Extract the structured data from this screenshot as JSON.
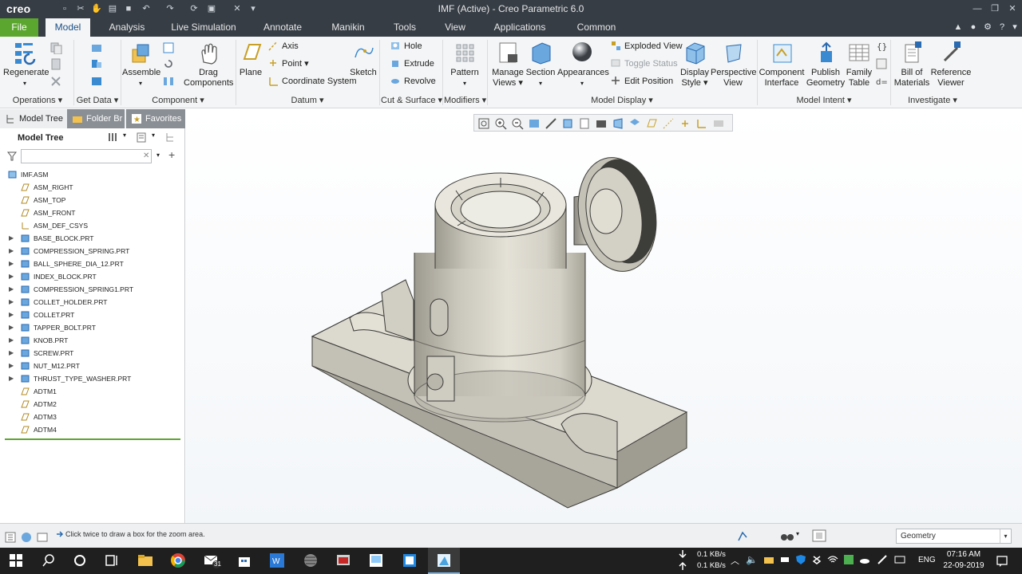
{
  "titlebar": {
    "app_logo": "creo",
    "title": "IMF (Active) - Creo Parametric 6.0"
  },
  "tabs": [
    "File",
    "Model",
    "Analysis",
    "Live Simulation",
    "Annotate",
    "Manikin",
    "Tools",
    "View",
    "Applications",
    "Common"
  ],
  "active_tab": "Model",
  "ribbon": {
    "operations": {
      "regenerate": "Regenerate",
      "group": "Operations"
    },
    "get_data": {
      "group": "Get Data"
    },
    "component": {
      "assemble": "Assemble",
      "drag": "Drag Components",
      "group": "Component"
    },
    "datum": {
      "plane": "Plane",
      "axis": "Axis",
      "point": "Point",
      "csys": "Coordinate System",
      "sketch": "Sketch",
      "group": "Datum"
    },
    "cut_surface": {
      "hole": "Hole",
      "extrude": "Extrude",
      "revolve": "Revolve",
      "group": "Cut & Surface"
    },
    "modifiers": {
      "pattern": "Pattern",
      "group": "Modifiers"
    },
    "model_display": {
      "manage_views": "Manage Views",
      "section": "Section",
      "appearances": "Appearances",
      "exploded_view": "Exploded View",
      "toggle_status": "Toggle Status",
      "edit_position": "Edit Position",
      "display_style": "Display Style",
      "perspective_view": "Perspective View",
      "group": "Model Display"
    },
    "model_intent": {
      "component_interface": "Component Interface",
      "publish_geometry": "Publish Geometry",
      "family_table": "Family Table",
      "group": "Model Intent"
    },
    "investigate": {
      "bom": "Bill of Materials",
      "reference_viewer": "Reference Viewer",
      "group": "Investigate"
    }
  },
  "left_panel": {
    "tabs": [
      "Model Tree",
      "Folder Br",
      "Favorites"
    ],
    "header": "Model Tree",
    "search_value": "",
    "tree": [
      {
        "label": "IMF.ASM",
        "type": "asm",
        "expand": false,
        "indent": 0
      },
      {
        "label": "ASM_RIGHT",
        "type": "plane",
        "expand": false,
        "indent": 1
      },
      {
        "label": "ASM_TOP",
        "type": "plane",
        "expand": false,
        "indent": 1
      },
      {
        "label": "ASM_FRONT",
        "type": "plane",
        "expand": false,
        "indent": 1
      },
      {
        "label": "ASM_DEF_CSYS",
        "type": "csys",
        "expand": false,
        "indent": 1
      },
      {
        "label": "BASE_BLOCK.PRT",
        "type": "part",
        "expand": true,
        "indent": 1
      },
      {
        "label": "COMPRESSION_SPRING.PRT",
        "type": "part",
        "expand": true,
        "indent": 1
      },
      {
        "label": "BALL_SPHERE_DIA_12.PRT",
        "type": "part",
        "expand": true,
        "indent": 1
      },
      {
        "label": "INDEX_BLOCK.PRT",
        "type": "part",
        "expand": true,
        "indent": 1
      },
      {
        "label": "COMPRESSION_SPRING1.PRT",
        "type": "part",
        "expand": true,
        "indent": 1
      },
      {
        "label": "COLLET_HOLDER.PRT",
        "type": "part",
        "expand": true,
        "indent": 1
      },
      {
        "label": "COLLET.PRT",
        "type": "part",
        "expand": true,
        "indent": 1
      },
      {
        "label": "TAPPER_BOLT.PRT",
        "type": "part",
        "expand": true,
        "indent": 1
      },
      {
        "label": "KNOB.PRT",
        "type": "part",
        "expand": true,
        "indent": 1
      },
      {
        "label": "SCREW.PRT",
        "type": "part",
        "expand": true,
        "indent": 1
      },
      {
        "label": "NUT_M12.PRT",
        "type": "part",
        "expand": true,
        "indent": 1
      },
      {
        "label": "THRUST_TYPE_WASHER.PRT",
        "type": "part",
        "expand": true,
        "indent": 1
      },
      {
        "label": "ADTM1",
        "type": "plane",
        "expand": false,
        "indent": 1
      },
      {
        "label": "ADTM2",
        "type": "plane",
        "expand": false,
        "indent": 1
      },
      {
        "label": "ADTM3",
        "type": "plane",
        "expand": false,
        "indent": 1
      },
      {
        "label": "ADTM4",
        "type": "plane",
        "expand": false,
        "indent": 1
      }
    ]
  },
  "statusbar": {
    "message": "Click twice to draw a box for the zoom area.",
    "filter": "Geometry"
  },
  "taskbar": {
    "net_down": "0.1 KB/s",
    "net_up": "0.1 KB/s",
    "lang": "ENG",
    "time": "07:16 AM",
    "date": "22-09-2019",
    "mail_badge": "31"
  },
  "colors": {
    "chrome": "#363d45",
    "file_tab": "#5aa62e",
    "model": "#d9d6cc"
  }
}
